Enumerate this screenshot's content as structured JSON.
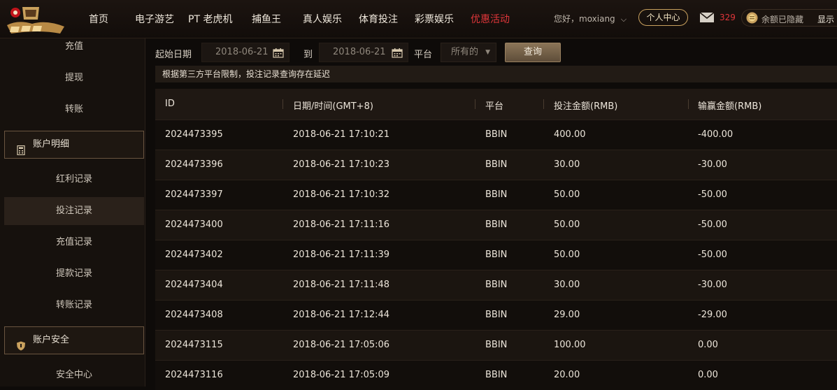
{
  "header": {
    "nav": [
      {
        "label": "首页"
      },
      {
        "label": "电子游艺"
      },
      {
        "label": "PT 老虎机"
      },
      {
        "label": "捕鱼王"
      },
      {
        "label": "真人娱乐"
      },
      {
        "label": "体育投注"
      },
      {
        "label": "彩票娱乐"
      },
      {
        "label": "优惠活动",
        "active": true
      }
    ],
    "greeting": "您好，moxiang",
    "personal_center": "个人中心",
    "mail_count": "329",
    "balance_hidden": "余额已隐藏",
    "balance_show": "显示",
    "accent_color": "#e0363a"
  },
  "sidebar": {
    "items_top": [
      "充值",
      "提现",
      "转账"
    ],
    "group_account": "账户明细",
    "items_account": [
      "红利记录",
      "投注记录",
      "充值记录",
      "提款记录",
      "转账记录"
    ],
    "selected": "投注记录",
    "group_security": "账户安全",
    "items_security": [
      "安全中心"
    ]
  },
  "filter": {
    "start_label": "起始日期",
    "start_date": "2018-06-21",
    "to_label": "到",
    "end_date": "2018-06-21",
    "platform_label": "平台",
    "platform_value": "所有的",
    "query_label": "查询"
  },
  "notice": "根据第三方平台限制，投注记录查询存在延迟",
  "table": {
    "columns": [
      "ID",
      "日期/时间(GMT+8)",
      "平台",
      "投注金额(RMB)",
      "输赢金额(RMB)"
    ],
    "rows": [
      [
        "2024473395",
        "2018-06-21 17:10:21",
        "BBIN",
        "400.00",
        "-400.00"
      ],
      [
        "2024473396",
        "2018-06-21 17:10:23",
        "BBIN",
        "30.00",
        "-30.00"
      ],
      [
        "2024473397",
        "2018-06-21 17:10:32",
        "BBIN",
        "50.00",
        "-50.00"
      ],
      [
        "2024473400",
        "2018-06-21 17:11:16",
        "BBIN",
        "50.00",
        "-50.00"
      ],
      [
        "2024473402",
        "2018-06-21 17:11:39",
        "BBIN",
        "50.00",
        "-50.00"
      ],
      [
        "2024473404",
        "2018-06-21 17:11:48",
        "BBIN",
        "30.00",
        "-30.00"
      ],
      [
        "2024473408",
        "2018-06-21 17:12:44",
        "BBIN",
        "29.00",
        "-29.00"
      ],
      [
        "2024473115",
        "2018-06-21 17:05:06",
        "BBIN",
        "100.00",
        "0.00"
      ],
      [
        "2024473116",
        "2018-06-21 17:05:09",
        "BBIN",
        "20.00",
        "0.00"
      ]
    ]
  }
}
